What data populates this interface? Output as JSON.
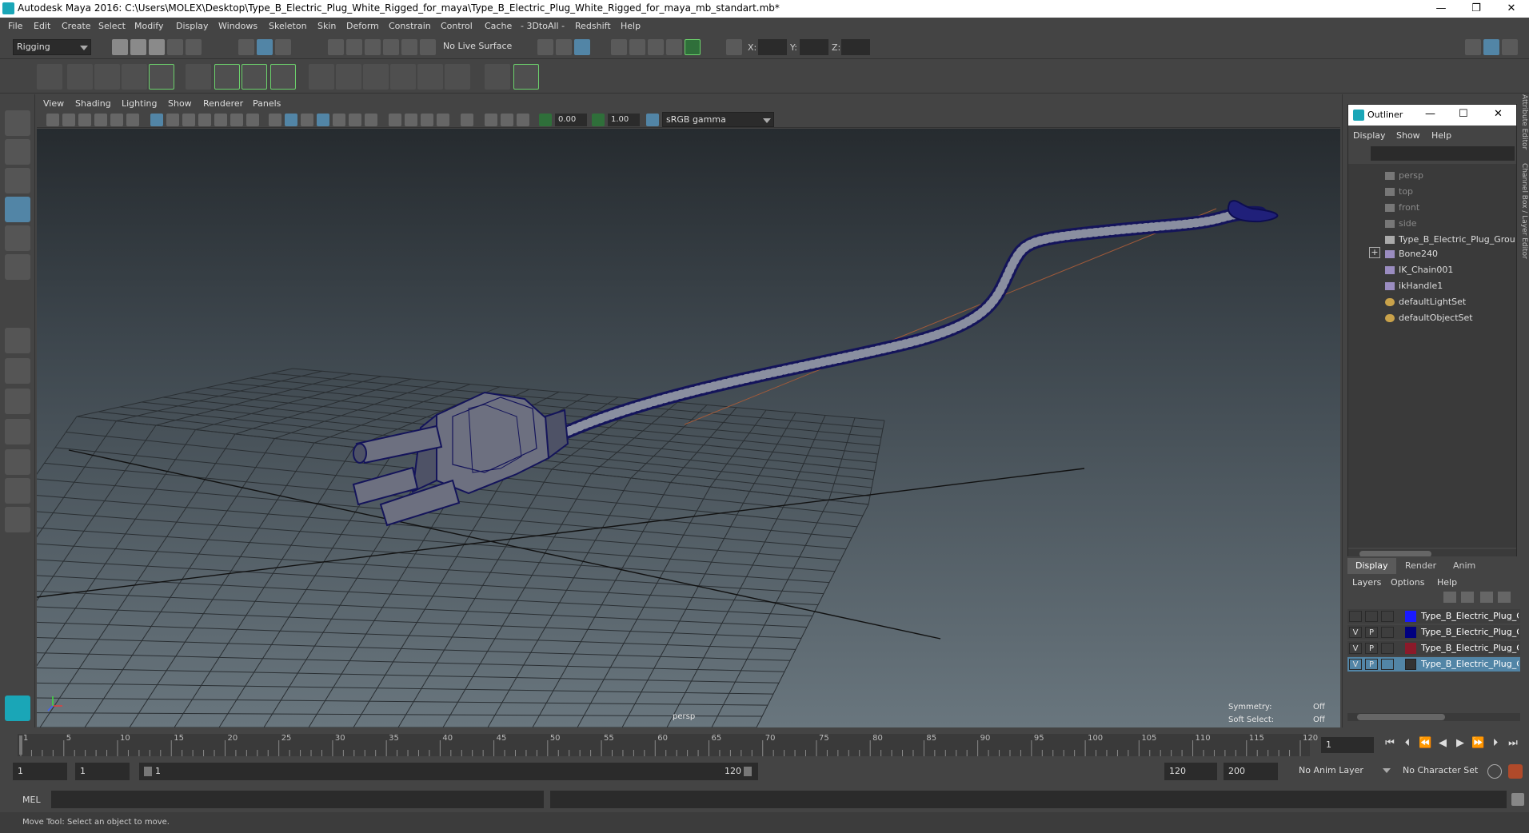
{
  "window": {
    "title": "Autodesk Maya 2016: C:\\Users\\MOLEX\\Desktop\\Type_B_Electric_Plug_White_Rigged_for_maya\\Type_B_Electric_Plug_White_Rigged_for_maya_mb_standart.mb*",
    "minimize": "—",
    "restore": "❐",
    "close": "✕"
  },
  "menu": [
    "File",
    "Edit",
    "Create",
    "Select",
    "Modify",
    "Display",
    "Windows",
    "Skeleton",
    "Skin",
    "Deform",
    "Constrain",
    "Control",
    "Cache",
    "- 3DtoAll -",
    "Redshift",
    "Help"
  ],
  "status": {
    "menuset": "Rigging",
    "live_surface": "No Live Surface",
    "x_label": "X:",
    "y_label": "Y:",
    "z_label": "Z:"
  },
  "viewport": {
    "menu": [
      "View",
      "Shading",
      "Lighting",
      "Show",
      "Renderer",
      "Panels"
    ],
    "exposure": "0.00",
    "gamma": "1.00",
    "colorspace": "sRGB gamma",
    "camera_label": "persp",
    "symmetry_label": "Symmetry:",
    "symmetry_value": "Off",
    "softselect_label": "Soft Select:",
    "softselect_value": "Off"
  },
  "outliner": {
    "title": "Outliner",
    "menu": [
      "Display",
      "Show",
      "Help"
    ],
    "items": [
      {
        "label": "persp",
        "dim": true
      },
      {
        "label": "top",
        "dim": true
      },
      {
        "label": "front",
        "dim": true
      },
      {
        "label": "side",
        "dim": true
      },
      {
        "label": "Type_B_Electric_Plug_Grou",
        "dim": false
      },
      {
        "label": "Bone240",
        "dim": false
      },
      {
        "label": "IK_Chain001",
        "dim": false
      },
      {
        "label": "ikHandle1",
        "dim": false
      },
      {
        "label": "defaultLightSet",
        "dim": false
      },
      {
        "label": "defaultObjectSet",
        "dim": false
      }
    ],
    "expand": "+",
    "side_tab_1": "Attribute Editor",
    "side_tab_2": "Channel Box / Layer Editor"
  },
  "layers": {
    "tabs": [
      "Display",
      "Render",
      "Anim"
    ],
    "menu": [
      "Layers",
      "Options",
      "Help"
    ],
    "rows": [
      {
        "v": "",
        "p": "",
        "color": "#1a1aff",
        "name": "Type_B_Electric_Plug_C"
      },
      {
        "v": "V",
        "p": "P",
        "color": "#000080",
        "name": "Type_B_Electric_Plug_Gro"
      },
      {
        "v": "V",
        "p": "P",
        "color": "#8b1a2a",
        "name": "Type_B_Electric_Plug_C"
      },
      {
        "v": "V",
        "p": "P",
        "color": "#333333",
        "name": "Type_B_Electric_Plug_C"
      }
    ]
  },
  "timeline": {
    "ticks": [
      "1",
      "5",
      "10",
      "15",
      "20",
      "25",
      "30",
      "35",
      "40",
      "45",
      "50",
      "55",
      "60",
      "65",
      "70",
      "75",
      "80",
      "85",
      "90",
      "95",
      "100",
      "105",
      "110",
      "115",
      "120"
    ],
    "current_frame": "1"
  },
  "range": {
    "start": "1",
    "inner_start": "1",
    "slider_start": "1",
    "slider_end": "120",
    "end": "120",
    "outer_end": "200",
    "anim_layer": "No Anim Layer",
    "char_set": "No Character Set"
  },
  "cmd": {
    "lang": "MEL"
  },
  "help": {
    "text": "Move Tool: Select an object to move."
  }
}
